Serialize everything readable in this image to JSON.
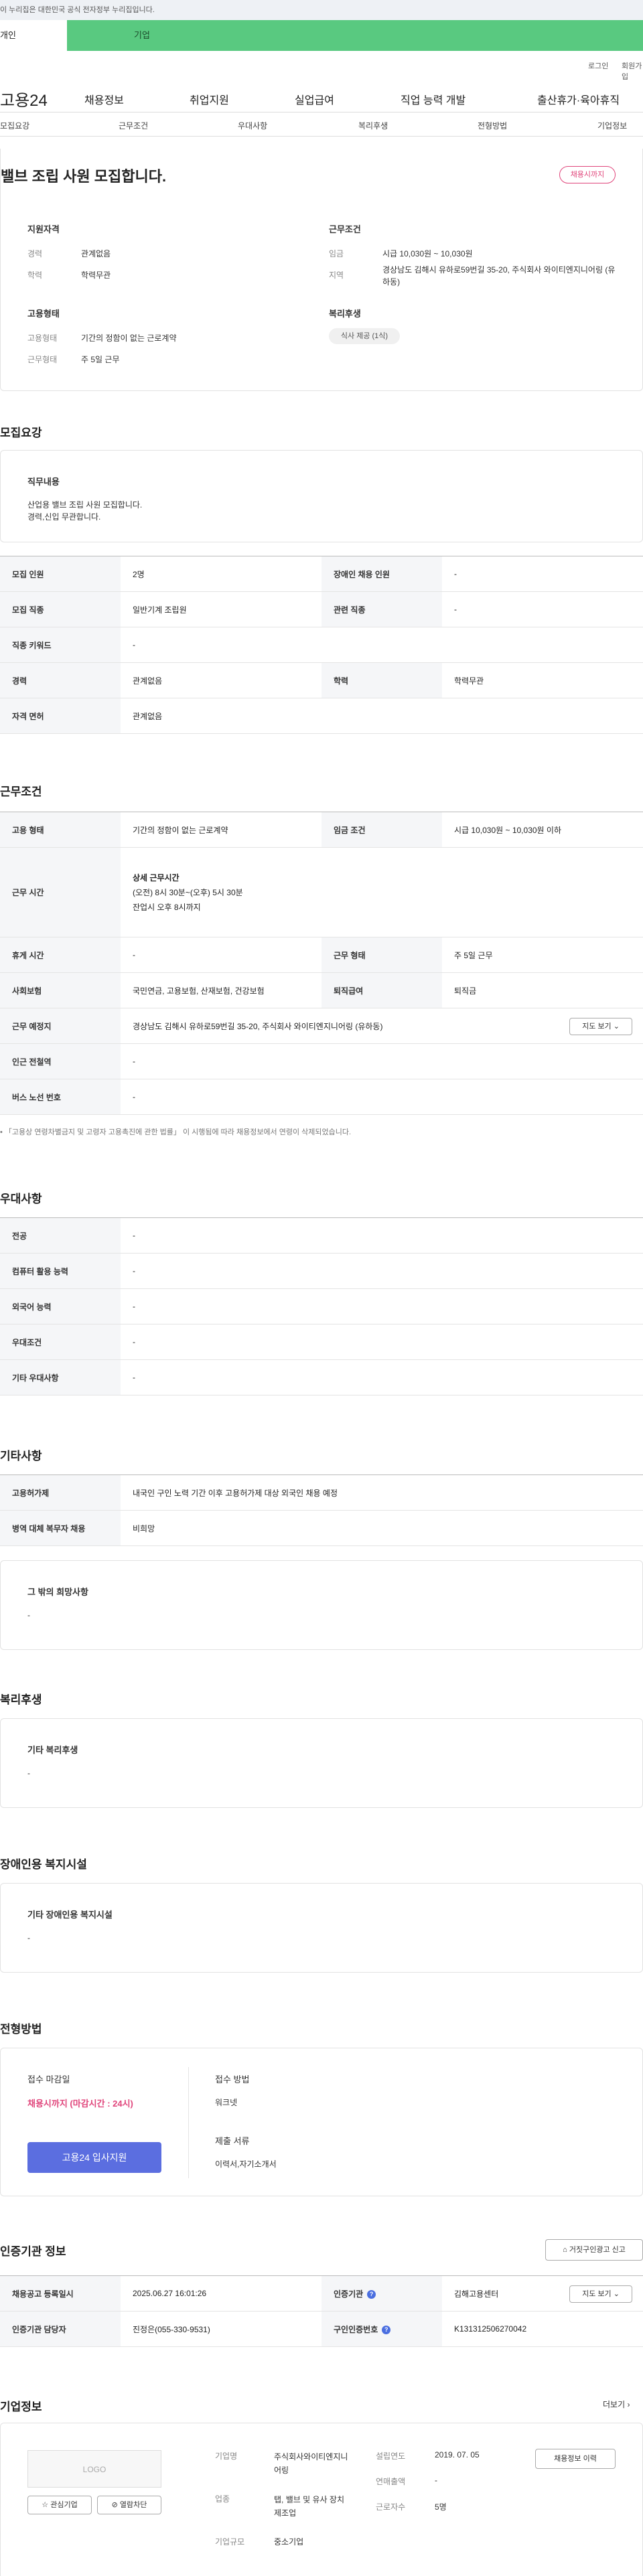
{
  "gov_banner": "이 누리집은 대한민국 공식 전자정부 누리집입니다.",
  "user_tabs": {
    "personal": "개인",
    "company": "기업"
  },
  "util": {
    "login": "로그인",
    "join": "회원가입"
  },
  "logo": "고용24",
  "gnb": [
    "채용정보",
    "취업지원",
    "실업급여",
    "직업 능력 개발",
    "출산휴가·육아휴직"
  ],
  "lnb": [
    "모집요강",
    "근무조건",
    "우대사항",
    "복리후생",
    "전형방법",
    "기업정보"
  ],
  "summary": {
    "title": "밸브 조립 사원 모집합니다.",
    "badge": "채용시까지",
    "qual_title": "지원자격",
    "career_label": "경력",
    "career": "관계없음",
    "edu_label": "학력",
    "edu": "학력무관",
    "emp_title": "고용형태",
    "emp_type_label": "고용형태",
    "emp_type": "기간의 정함이 없는 근로계약",
    "work_type_label": "근무형태",
    "work_type": "주 5일 근무",
    "cond_title": "근무조건",
    "wage_label": "임금",
    "wage": "시급 10,030원 ~ 10,030원",
    "region_label": "지역",
    "region": "경상남도 김해시 유하로59번길 35-20, 주식회사 와이티엔지니어링 (유하동)",
    "welfare_title": "복리후생",
    "welfare_chip": "식사 제공 (1식)"
  },
  "recruit": {
    "section": "모집요강",
    "duty_title": "직무내용",
    "duty_line1": "산업용 밸브 조립 사원 모집합니다.",
    "duty_line2": "경력,신입 무관합니다.",
    "rows": [
      [
        "모집 인원",
        "2명",
        "장애인 채용 인원",
        "-"
      ],
      [
        "모집 직종",
        "일반기계 조립원",
        "관련 직종",
        "-"
      ],
      [
        "직종 키워드",
        "-",
        "",
        ""
      ],
      [
        "경력",
        "관계없음",
        "학력",
        "학력무관"
      ],
      [
        "자격 면허",
        "관계없음",
        "",
        ""
      ]
    ]
  },
  "conditions": {
    "section": "근무조건",
    "emp_label": "고용 형태",
    "emp": "기간의 정함이 없는 근로계약",
    "wage_label": "임금 조건",
    "wage": "시급 10,030원 ~ 10,030원 이하",
    "hours_label": "근무 시간",
    "hours_title": "상세 근무시간",
    "hours_1": "(오전) 8시 30분~(오후) 5시 30분",
    "hours_2": "잔업시 오후 8시까지",
    "rest_label": "휴게 시간",
    "rest": "-",
    "worktype_label": "근무 형태",
    "worktype": "주 5일 근무",
    "insurance_label": "사회보험",
    "insurance": "국민연금, 고용보험, 산재보험, 건강보험",
    "severance_label": "퇴직급여",
    "severance": "퇴직금",
    "place_label": "근무 예정지",
    "place": "경상남도 김해시 유하로59번길 35-20, 주식회사 와이티엔지니어링 (유하동)",
    "map_btn": "지도 보기",
    "subway_label": "인근 전철역",
    "subway": "-",
    "bus_label": "버스 노선 번호",
    "bus": "-",
    "note": "「고용상 연령차별금지 및 고령자 고용촉진에 관한 법률」 이 시행됨에 따라 채용정보에서 연령이 삭제되었습니다."
  },
  "preference": {
    "section": "우대사항",
    "rows": [
      [
        "전공",
        "-"
      ],
      [
        "컴퓨터 활용 능력",
        "-"
      ],
      [
        "외국어 능력",
        "-"
      ],
      [
        "우대조건",
        "-"
      ],
      [
        "기타 우대사항",
        "-"
      ]
    ]
  },
  "etc": {
    "section": "기타사항",
    "rows": [
      [
        "고용허가제",
        "내국인 구인 노력 기간 이후 고용허가제 대상 외국인 채용 예정"
      ],
      [
        "병역 대체 복무자 채용",
        "비희망"
      ]
    ],
    "hope_title": "그 밖의 희망사항",
    "hope": "-"
  },
  "welfare": {
    "section": "복리후생",
    "title": "기타 복리후생",
    "value": "-"
  },
  "disabled": {
    "section": "장애인용 복지시설",
    "title": "기타 장애인용 복지시설",
    "value": "-"
  },
  "selection": {
    "section": "전형방법",
    "deadline_title": "접수 마감일",
    "deadline": "채용시까지 (마감시간 : 24시)",
    "apply_btn": "고용24 입사지원",
    "method_title": "접수 방법",
    "method": "워크넷",
    "docs_title": "제출 서류",
    "docs": "이력서,자기소개서"
  },
  "cert": {
    "section": "인증기관 정보",
    "report_btn": "거짓구인광고 신고",
    "reg_label": "채용공고 등록일시",
    "reg": "2025.06.27 16:01:26",
    "org_label": "인증기관",
    "org": "김해고용센터",
    "map_btn": "지도 보기",
    "person_label": "인증기관 담당자",
    "person": "진정은(055-330-9531)",
    "cert_no_label": "구인인증번호",
    "cert_no": "K131312506270042"
  },
  "company": {
    "section": "기업정보",
    "more": "더보기",
    "logo": "LOGO",
    "fav_btn": "관심기업",
    "block_btn": "열람차단",
    "name_label": "기업명",
    "name": "주식회사와이티엔지니어링",
    "industry_label": "업종",
    "industry": "탭, 밸브 및 유사 장치 제조업",
    "size_label": "기업규모",
    "size": "중소기업",
    "founded_label": "설립연도",
    "founded": "2019. 07. 05",
    "sales_label": "연매출액",
    "sales": "-",
    "employees_label": "근로자수",
    "employees": "5명",
    "history_btn": "채용정보 이력"
  }
}
